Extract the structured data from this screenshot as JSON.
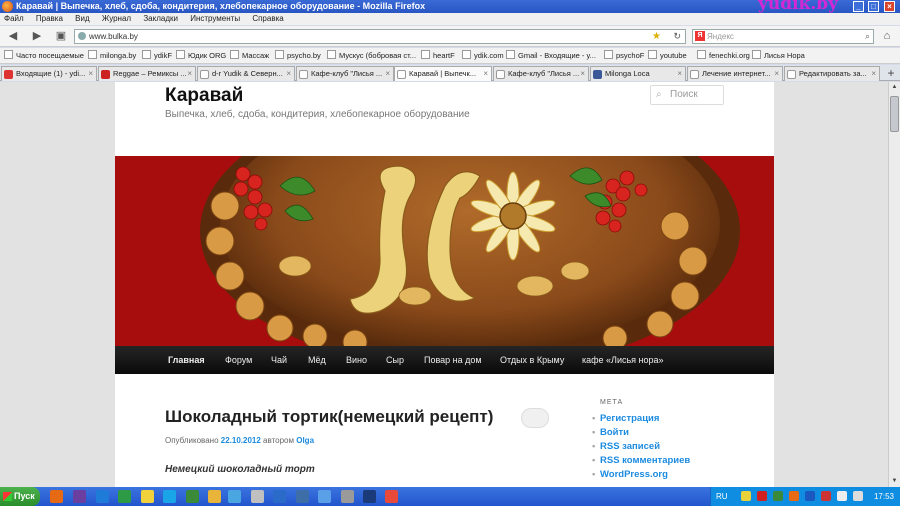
{
  "window": {
    "title": "Каравай | Выпечка, хлеб, сдоба, кондитерия, хлебопекарное оборудование - Mozilla Firefox",
    "watermark": "yudik.by"
  },
  "menu": [
    "Файл",
    "Правка",
    "Вид",
    "Журнал",
    "Закладки",
    "Инструменты",
    "Справка"
  ],
  "navbar": {
    "url": "www.bulka.by",
    "search_placeholder": "Яндекс",
    "search_logo": "Я"
  },
  "bookmarks": [
    "Часто посещаемые",
    "milonga.by",
    "ydikF",
    "Юдик ORG",
    "Массаж",
    "psycho.by",
    "Мускус (бобровая ст...",
    "heartF",
    "ydik.com",
    "Gmail - Входящие - y...",
    "psychoF",
    "youtube",
    "fenechki.org",
    "Лисья Нора"
  ],
  "tabs": [
    "Входящие (1) - ydi...",
    "Reggae – Ремиксы ...",
    "d-r Yudik & Северн...",
    "Кафе-клуб \"Лисья ...",
    "Каравай | Выпечк...",
    "Кафе-клуб \"Лисья ...",
    "Milonga Loca",
    "Лечение интернет...",
    "Редактировать за..."
  ],
  "site": {
    "title": "Каравай",
    "description": "Выпечка, хлеб, сдоба, кондитерия, хлебопекарное оборудование",
    "search_placeholder": "Поиск"
  },
  "main_nav": [
    "Главная",
    "Форум",
    "Чай",
    "Мёд",
    "Вино",
    "Сыр",
    "Повар на дом",
    "Отдых в Крыму",
    "кафе «Лисья нора»"
  ],
  "post": {
    "title": "Шоколадный тортик(немецкий рецепт)",
    "meta_prefix": "Опубликовано",
    "date": "22.10.2012",
    "meta_author_prefix": "автором",
    "author": "Olga",
    "body_first_line": "Немецкий шоколадный торт"
  },
  "sidebar": {
    "widget_title": "МЕТА",
    "links": [
      "Регистрация",
      "Войти",
      "RSS записей",
      "RSS комментариев",
      "WordPress.org"
    ]
  },
  "taskbar": {
    "start_label": "Пуск",
    "language": "RU",
    "clock": "17:53"
  }
}
